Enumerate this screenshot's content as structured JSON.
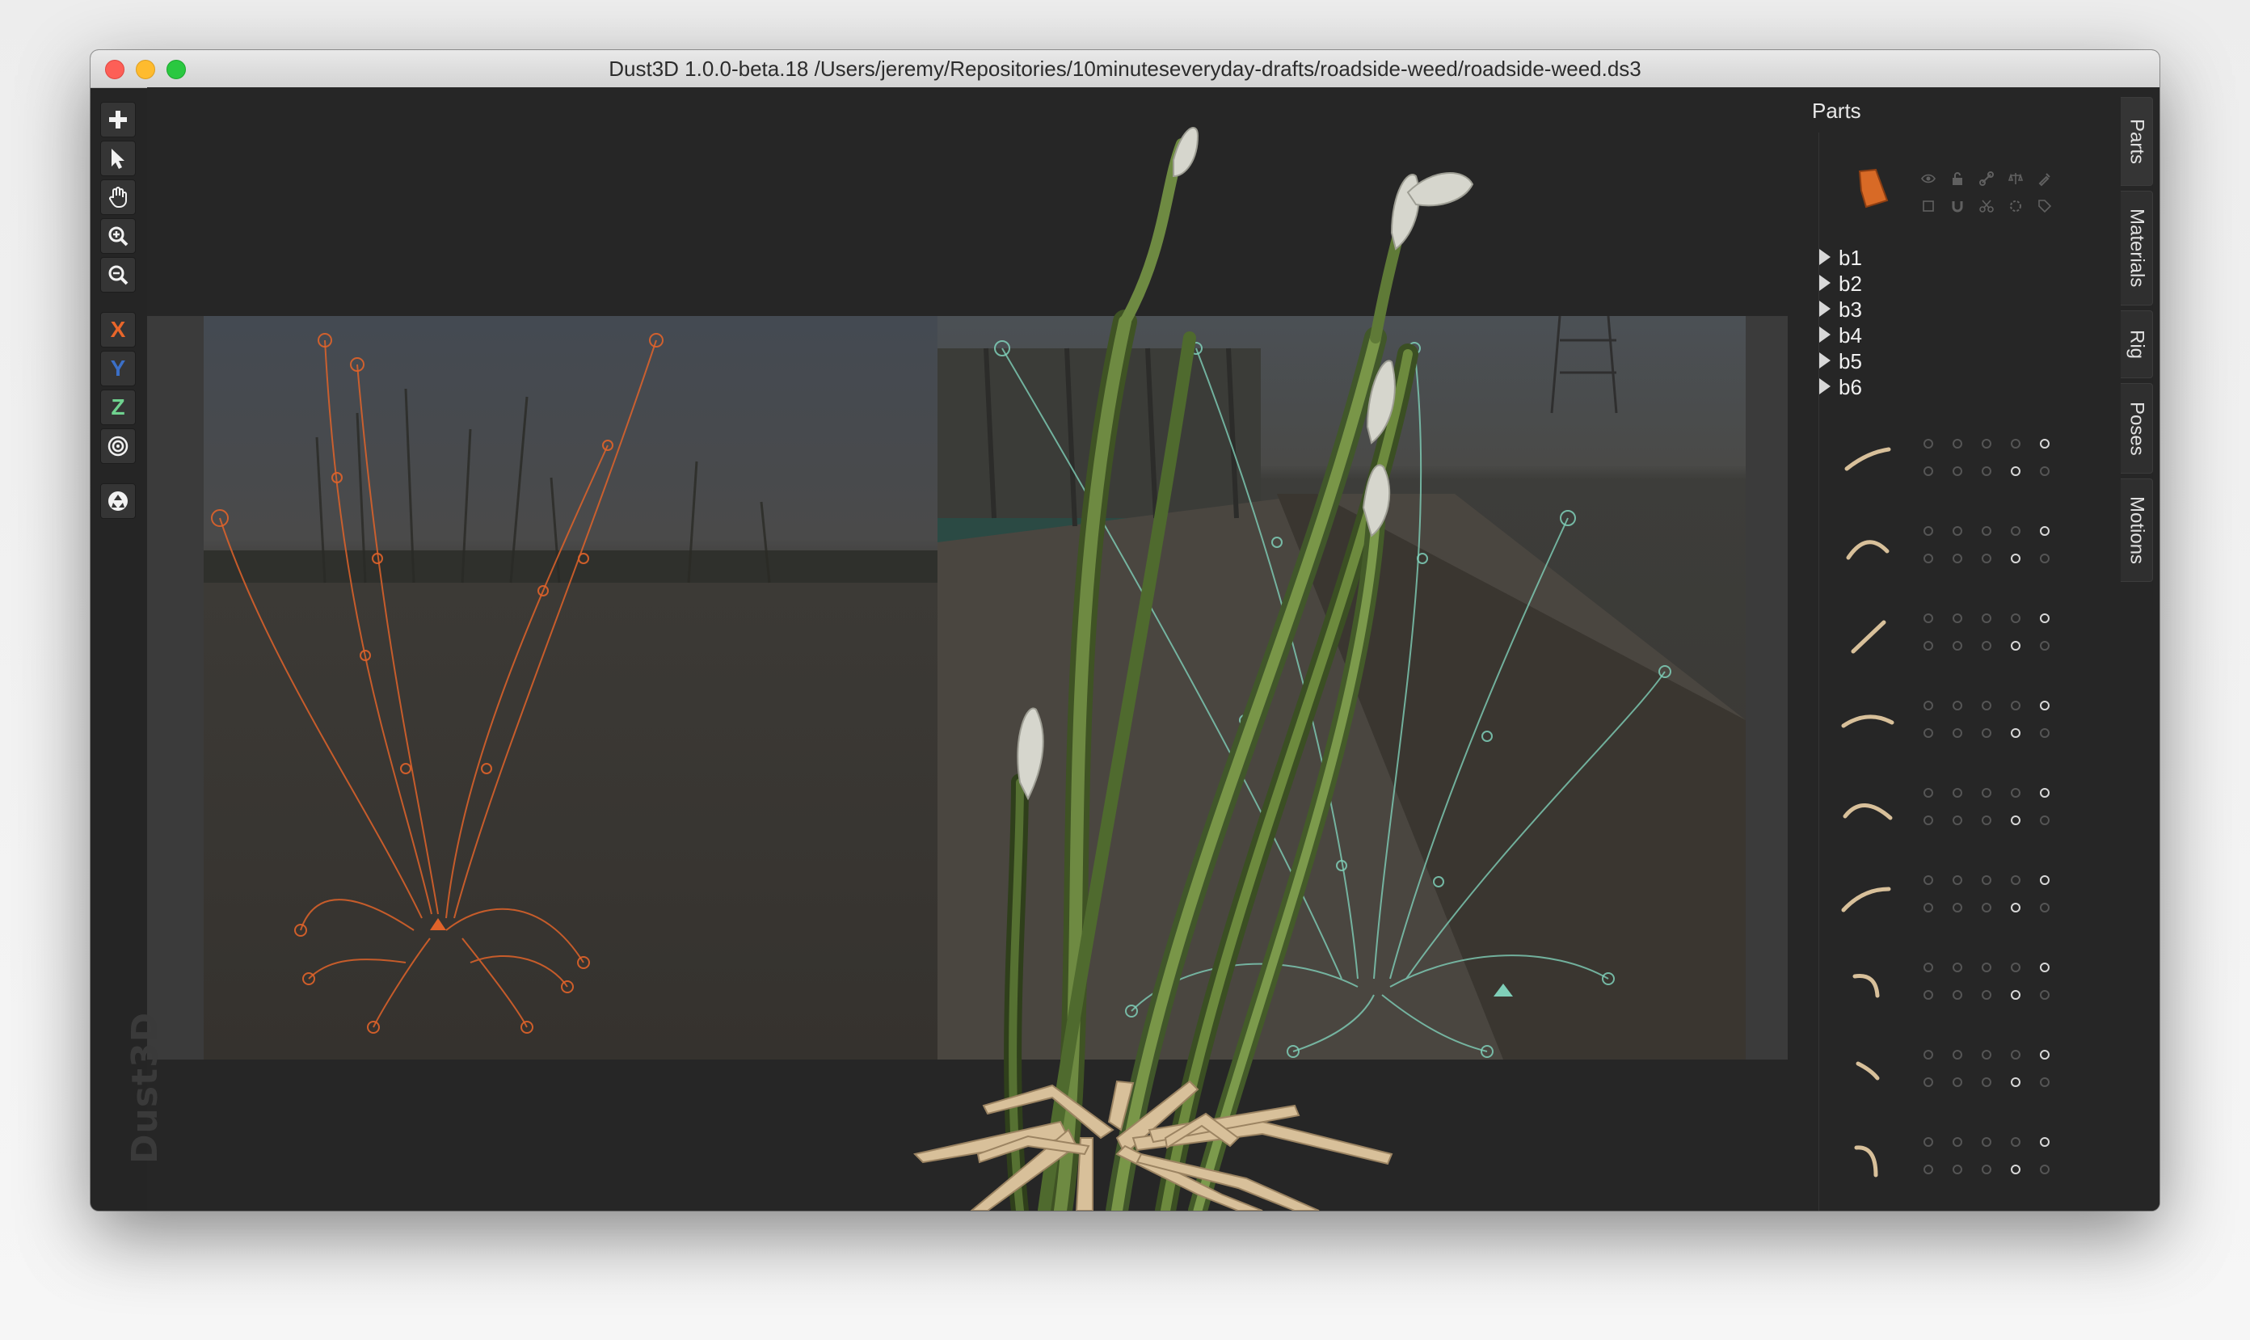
{
  "window": {
    "title": "Dust3D 1.0.0-beta.18 /Users/jeremy/Repositories/10minuteseveryday-drafts/roadside-weed/roadside-weed.ds3"
  },
  "toolbar": {
    "tools": [
      {
        "name": "add-icon",
        "kind": "icon"
      },
      {
        "name": "select-icon",
        "kind": "icon"
      },
      {
        "name": "hand-icon",
        "kind": "icon"
      },
      {
        "name": "zoom-in-icon",
        "kind": "icon"
      },
      {
        "name": "zoom-out-icon",
        "kind": "icon"
      }
    ],
    "axes": [
      {
        "label": "X",
        "color": "#e8662a"
      },
      {
        "label": "Y",
        "color": "#3b6fc7"
      },
      {
        "label": "Z",
        "color": "#6fd28f"
      }
    ],
    "extra_tools": [
      "radial-toggle-icon",
      "recycle-icon"
    ]
  },
  "watermark": "Dust3D",
  "parts_panel": {
    "title": "Parts",
    "groups": [
      "b1",
      "b2",
      "b3",
      "b4",
      "b5",
      "b6"
    ]
  },
  "side_tabs": [
    "Parts",
    "Materials",
    "Rig",
    "Poses",
    "Motions"
  ],
  "colors": {
    "front_guide": "#e0632a",
    "side_guide": "#7fcfb8",
    "stem": "#5f7a37",
    "blade": "#d8c09a",
    "bud": "#d8d8cf",
    "orange_part": "#d86a26"
  }
}
